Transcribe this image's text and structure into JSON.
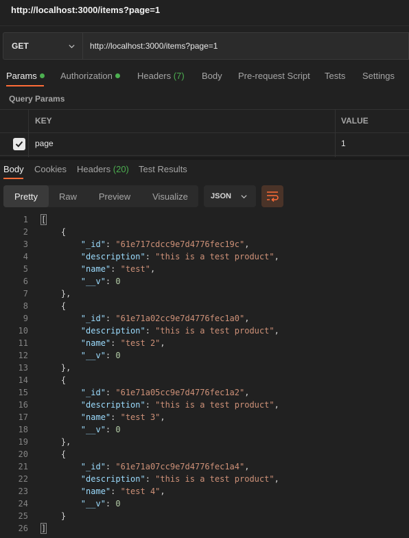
{
  "window": {
    "title": "http://localhost:3000/items?page=1"
  },
  "request": {
    "method": "GET",
    "url": "http://localhost:3000/items?page=1"
  },
  "request_tabs": [
    {
      "label": "Params",
      "dot": true,
      "active": true
    },
    {
      "label": "Authorization",
      "dot": true
    },
    {
      "label": "Headers",
      "count": "(7)"
    },
    {
      "label": "Body"
    },
    {
      "label": "Pre-request Script"
    },
    {
      "label": "Tests"
    },
    {
      "label": "Settings"
    }
  ],
  "query_params": {
    "label": "Query Params",
    "columns": [
      "KEY",
      "VALUE"
    ],
    "rows": [
      {
        "checked": true,
        "key": "page",
        "value": "1"
      }
    ]
  },
  "response_tabs": [
    {
      "label": "Body",
      "active": true
    },
    {
      "label": "Cookies"
    },
    {
      "label": "Headers",
      "count": "(20)"
    },
    {
      "label": "Test Results"
    }
  ],
  "view_modes": [
    "Pretty",
    "Raw",
    "Preview",
    "Visualize"
  ],
  "active_view": "Pretty",
  "format": "JSON",
  "colors": {
    "accent": "#ff6c37",
    "dot": "#4caf50",
    "key": "#9cdcfe",
    "string": "#ce9178",
    "number": "#b5cea8"
  },
  "icons": [
    "chevron-down-icon",
    "checkbox-checked-icon",
    "wrap-lines-icon",
    "green-dot-icon"
  ],
  "response_body": [
    {
      "n": "1",
      "t": [
        [
          "p",
          "["
        ]
      ]
    },
    {
      "n": "2",
      "t": [
        [
          "p",
          "    {"
        ]
      ]
    },
    {
      "n": "3",
      "t": [
        [
          "p",
          "        "
        ],
        [
          "k",
          "\"_id\""
        ],
        [
          "p",
          ": "
        ],
        [
          "s",
          "\"61e717cdcc9e7d4776fec19c\""
        ],
        [
          "p",
          ","
        ]
      ]
    },
    {
      "n": "4",
      "t": [
        [
          "p",
          "        "
        ],
        [
          "k",
          "\"description\""
        ],
        [
          "p",
          ": "
        ],
        [
          "s",
          "\"this is a test product\""
        ],
        [
          "p",
          ","
        ]
      ]
    },
    {
      "n": "5",
      "t": [
        [
          "p",
          "        "
        ],
        [
          "k",
          "\"name\""
        ],
        [
          "p",
          ": "
        ],
        [
          "s",
          "\"test\""
        ],
        [
          "p",
          ","
        ]
      ]
    },
    {
      "n": "6",
      "t": [
        [
          "p",
          "        "
        ],
        [
          "k",
          "\"__v\""
        ],
        [
          "p",
          ": "
        ],
        [
          "n",
          "0"
        ]
      ]
    },
    {
      "n": "7",
      "t": [
        [
          "p",
          "    },"
        ]
      ]
    },
    {
      "n": "8",
      "t": [
        [
          "p",
          "    {"
        ]
      ]
    },
    {
      "n": "9",
      "t": [
        [
          "p",
          "        "
        ],
        [
          "k",
          "\"_id\""
        ],
        [
          "p",
          ": "
        ],
        [
          "s",
          "\"61e71a02cc9e7d4776fec1a0\""
        ],
        [
          "p",
          ","
        ]
      ]
    },
    {
      "n": "10",
      "t": [
        [
          "p",
          "        "
        ],
        [
          "k",
          "\"description\""
        ],
        [
          "p",
          ": "
        ],
        [
          "s",
          "\"this is a test product\""
        ],
        [
          "p",
          ","
        ]
      ]
    },
    {
      "n": "11",
      "t": [
        [
          "p",
          "        "
        ],
        [
          "k",
          "\"name\""
        ],
        [
          "p",
          ": "
        ],
        [
          "s",
          "\"test 2\""
        ],
        [
          "p",
          ","
        ]
      ]
    },
    {
      "n": "12",
      "t": [
        [
          "p",
          "        "
        ],
        [
          "k",
          "\"__v\""
        ],
        [
          "p",
          ": "
        ],
        [
          "n",
          "0"
        ]
      ]
    },
    {
      "n": "13",
      "t": [
        [
          "p",
          "    },"
        ]
      ]
    },
    {
      "n": "14",
      "t": [
        [
          "p",
          "    {"
        ]
      ]
    },
    {
      "n": "15",
      "t": [
        [
          "p",
          "        "
        ],
        [
          "k",
          "\"_id\""
        ],
        [
          "p",
          ": "
        ],
        [
          "s",
          "\"61e71a05cc9e7d4776fec1a2\""
        ],
        [
          "p",
          ","
        ]
      ]
    },
    {
      "n": "16",
      "t": [
        [
          "p",
          "        "
        ],
        [
          "k",
          "\"description\""
        ],
        [
          "p",
          ": "
        ],
        [
          "s",
          "\"this is a test product\""
        ],
        [
          "p",
          ","
        ]
      ]
    },
    {
      "n": "17",
      "t": [
        [
          "p",
          "        "
        ],
        [
          "k",
          "\"name\""
        ],
        [
          "p",
          ": "
        ],
        [
          "s",
          "\"test 3\""
        ],
        [
          "p",
          ","
        ]
      ]
    },
    {
      "n": "18",
      "t": [
        [
          "p",
          "        "
        ],
        [
          "k",
          "\"__v\""
        ],
        [
          "p",
          ": "
        ],
        [
          "n",
          "0"
        ]
      ]
    },
    {
      "n": "19",
      "t": [
        [
          "p",
          "    },"
        ]
      ]
    },
    {
      "n": "20",
      "t": [
        [
          "p",
          "    {"
        ]
      ]
    },
    {
      "n": "21",
      "t": [
        [
          "p",
          "        "
        ],
        [
          "k",
          "\"_id\""
        ],
        [
          "p",
          ": "
        ],
        [
          "s",
          "\"61e71a07cc9e7d4776fec1a4\""
        ],
        [
          "p",
          ","
        ]
      ]
    },
    {
      "n": "22",
      "t": [
        [
          "p",
          "        "
        ],
        [
          "k",
          "\"description\""
        ],
        [
          "p",
          ": "
        ],
        [
          "s",
          "\"this is a test product\""
        ],
        [
          "p",
          ","
        ]
      ]
    },
    {
      "n": "23",
      "t": [
        [
          "p",
          "        "
        ],
        [
          "k",
          "\"name\""
        ],
        [
          "p",
          ": "
        ],
        [
          "s",
          "\"test 4\""
        ],
        [
          "p",
          ","
        ]
      ]
    },
    {
      "n": "24",
      "t": [
        [
          "p",
          "        "
        ],
        [
          "k",
          "\"__v\""
        ],
        [
          "p",
          ": "
        ],
        [
          "n",
          "0"
        ]
      ]
    },
    {
      "n": "25",
      "t": [
        [
          "p",
          "    }"
        ]
      ]
    },
    {
      "n": "26",
      "t": [
        [
          "p",
          "]"
        ]
      ]
    }
  ]
}
